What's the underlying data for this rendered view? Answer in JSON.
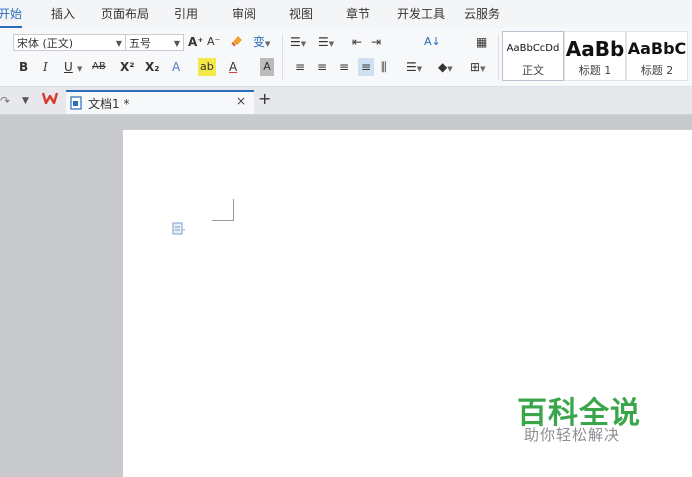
{
  "menu": {
    "tabs": [
      "开始",
      "插入",
      "页面布局",
      "引用",
      "审阅",
      "视图",
      "章节",
      "开发工具",
      "云服务"
    ],
    "active_index": 0
  },
  "ribbon": {
    "font_name": "宋体 (正文)",
    "font_size": "五号",
    "grow_font": "A⁺",
    "shrink_font": "A⁻",
    "phonetic": "变",
    "bold": "B",
    "italic": "I",
    "underline": "U",
    "strikethrough": "AB",
    "superscript": "X²",
    "subscript": "X₂",
    "text_effect": "A",
    "highlight": "ab",
    "font_color": "A",
    "char_shading": "A",
    "sort": "A↓",
    "styles": [
      {
        "sample": "AaBbCcDd",
        "name": "正文"
      },
      {
        "sample": "AaBb",
        "name": "标题 1"
      },
      {
        "sample": "AaBbC",
        "name": "标题 2"
      }
    ]
  },
  "tabbar": {
    "doc_title": "文档1 *",
    "close": "×",
    "new_tab": "+"
  },
  "watermark": {
    "title": "百科全说",
    "subtitle": "助你轻松解决"
  },
  "colors": {
    "accent": "#2a6ebb",
    "wps_red": "#d83a2e",
    "watermark_green": "#3aa64b"
  },
  "icons": {
    "phonetic": "phonetic-guide-icon",
    "clear_format": "clear-format-icon",
    "wps_logo": "wps-logo-icon",
    "doc": "document-icon",
    "paragraph_mark": "paragraph-options-icon"
  }
}
